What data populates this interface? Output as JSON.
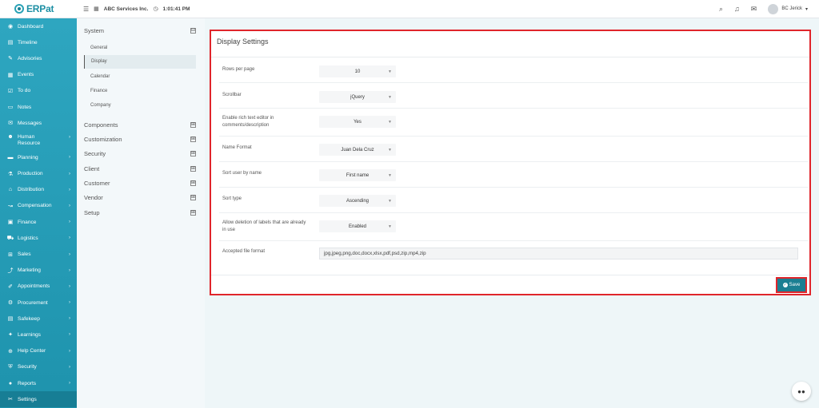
{
  "topbar": {
    "logo_text": "ERPat",
    "company": "ABC Services Inc.",
    "time": "1:01:41 PM",
    "user_name": "BC Jerick",
    "user_caret": "▾"
  },
  "sidebar": {
    "items": [
      {
        "label": "Dashboard",
        "icon": "◉",
        "chev": ""
      },
      {
        "label": "Timeline",
        "icon": "▤",
        "chev": ""
      },
      {
        "label": "Advisories",
        "icon": "✎",
        "chev": ""
      },
      {
        "label": "Events",
        "icon": "▦",
        "chev": ""
      },
      {
        "label": "To do",
        "icon": "☑",
        "chev": ""
      },
      {
        "label": "Notes",
        "icon": "▭",
        "chev": ""
      },
      {
        "label": "Messages",
        "icon": "✉",
        "chev": ""
      },
      {
        "label": "Human\nResource",
        "icon": "☻",
        "chev": "›"
      },
      {
        "label": "Planning",
        "icon": "▬",
        "chev": "›"
      },
      {
        "label": "Production",
        "icon": "⚗",
        "chev": "›"
      },
      {
        "label": "Distribution",
        "icon": "⌂",
        "chev": "›"
      },
      {
        "label": "Compensation",
        "icon": "↝",
        "chev": "›"
      },
      {
        "label": "Finance",
        "icon": "▣",
        "chev": "›"
      },
      {
        "label": "Logistics",
        "icon": "⛟",
        "chev": "›"
      },
      {
        "label": "Sales",
        "icon": "⊞",
        "chev": "›"
      },
      {
        "label": "Marketing",
        "icon": "⤴",
        "chev": "›"
      },
      {
        "label": "Appointments",
        "icon": "✐",
        "chev": "›"
      },
      {
        "label": "Procurement",
        "icon": "⚙",
        "chev": "›"
      },
      {
        "label": "Safekeep",
        "icon": "▤",
        "chev": "›"
      },
      {
        "label": "Learnings",
        "icon": "✦",
        "chev": "›"
      },
      {
        "label": "Help Center",
        "icon": "⊕",
        "chev": "›"
      },
      {
        "label": "Security",
        "icon": "⛨",
        "chev": "›"
      },
      {
        "label": "Reports",
        "icon": "●",
        "chev": "›"
      },
      {
        "label": "Settings",
        "icon": "✂",
        "chev": ""
      }
    ]
  },
  "settings_menu": {
    "system": "System",
    "collapse_symbol": "⊟",
    "expand_symbol": "⊞",
    "system_items": [
      "General",
      "Display",
      "Calendar",
      "Finance",
      "Company"
    ],
    "groups": [
      "Components",
      "Customization",
      "Security",
      "Client",
      "Customer",
      "Vendor",
      "Setup"
    ]
  },
  "display_settings": {
    "title": "Display Settings",
    "rows": [
      {
        "label": "Rows per page",
        "value": "10"
      },
      {
        "label": "Scrollbar",
        "value": "jQuery"
      },
      {
        "label": "Enable rich text editor in comments/description",
        "value": "Yes"
      },
      {
        "label": "Name Format",
        "value": "Juan Dela Cruz"
      },
      {
        "label": "Sort user by name",
        "value": "First name"
      },
      {
        "label": "Sort type",
        "value": "Ascending"
      },
      {
        "label": "Allow deletion of labels that are already in use",
        "value": "Enabled"
      }
    ],
    "file_format_label": "Accepted file format",
    "file_format_value": "jpg,jpeg,png,doc,docx,xlsx,pdf,psd,zip,mp4,zip",
    "save_label": "Save"
  },
  "colors": {
    "accent": "#1b7f92",
    "sidebar": "#2ea6c0",
    "highlight_border": "#e0252b"
  }
}
